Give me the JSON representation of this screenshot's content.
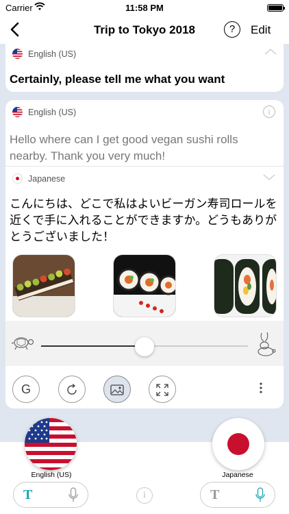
{
  "status_bar": {
    "carrier": "Carrier",
    "time": "11:58 PM"
  },
  "nav": {
    "title": "Trip to Tokyo 2018",
    "help": "?",
    "edit_label": "Edit"
  },
  "card_previous": {
    "language": "English (US)",
    "text": "Certainly, please tell me what you want"
  },
  "card_current": {
    "source_language": "English (US)",
    "source_text": "Hello where can I get good vegan sushi rolls nearby. Thank you very much!",
    "target_language": "Japanese",
    "target_text": "こんにちは、どこで私はよいビーガン寿司ロールを近くで手に入れることができますか。どうもありがとうございました！",
    "info": "i",
    "tools": {
      "g_label": "G"
    }
  },
  "speed": {
    "level": 0.5
  },
  "bottom": {
    "left_language": "English (US)",
    "right_language": "Japanese",
    "t_label": "T",
    "info": "i"
  },
  "colors": {
    "accent": "#1ba6b5",
    "flag_red": "#c8102e",
    "flag_blue": "#1e3a8a",
    "background": "#dfe6ef"
  }
}
